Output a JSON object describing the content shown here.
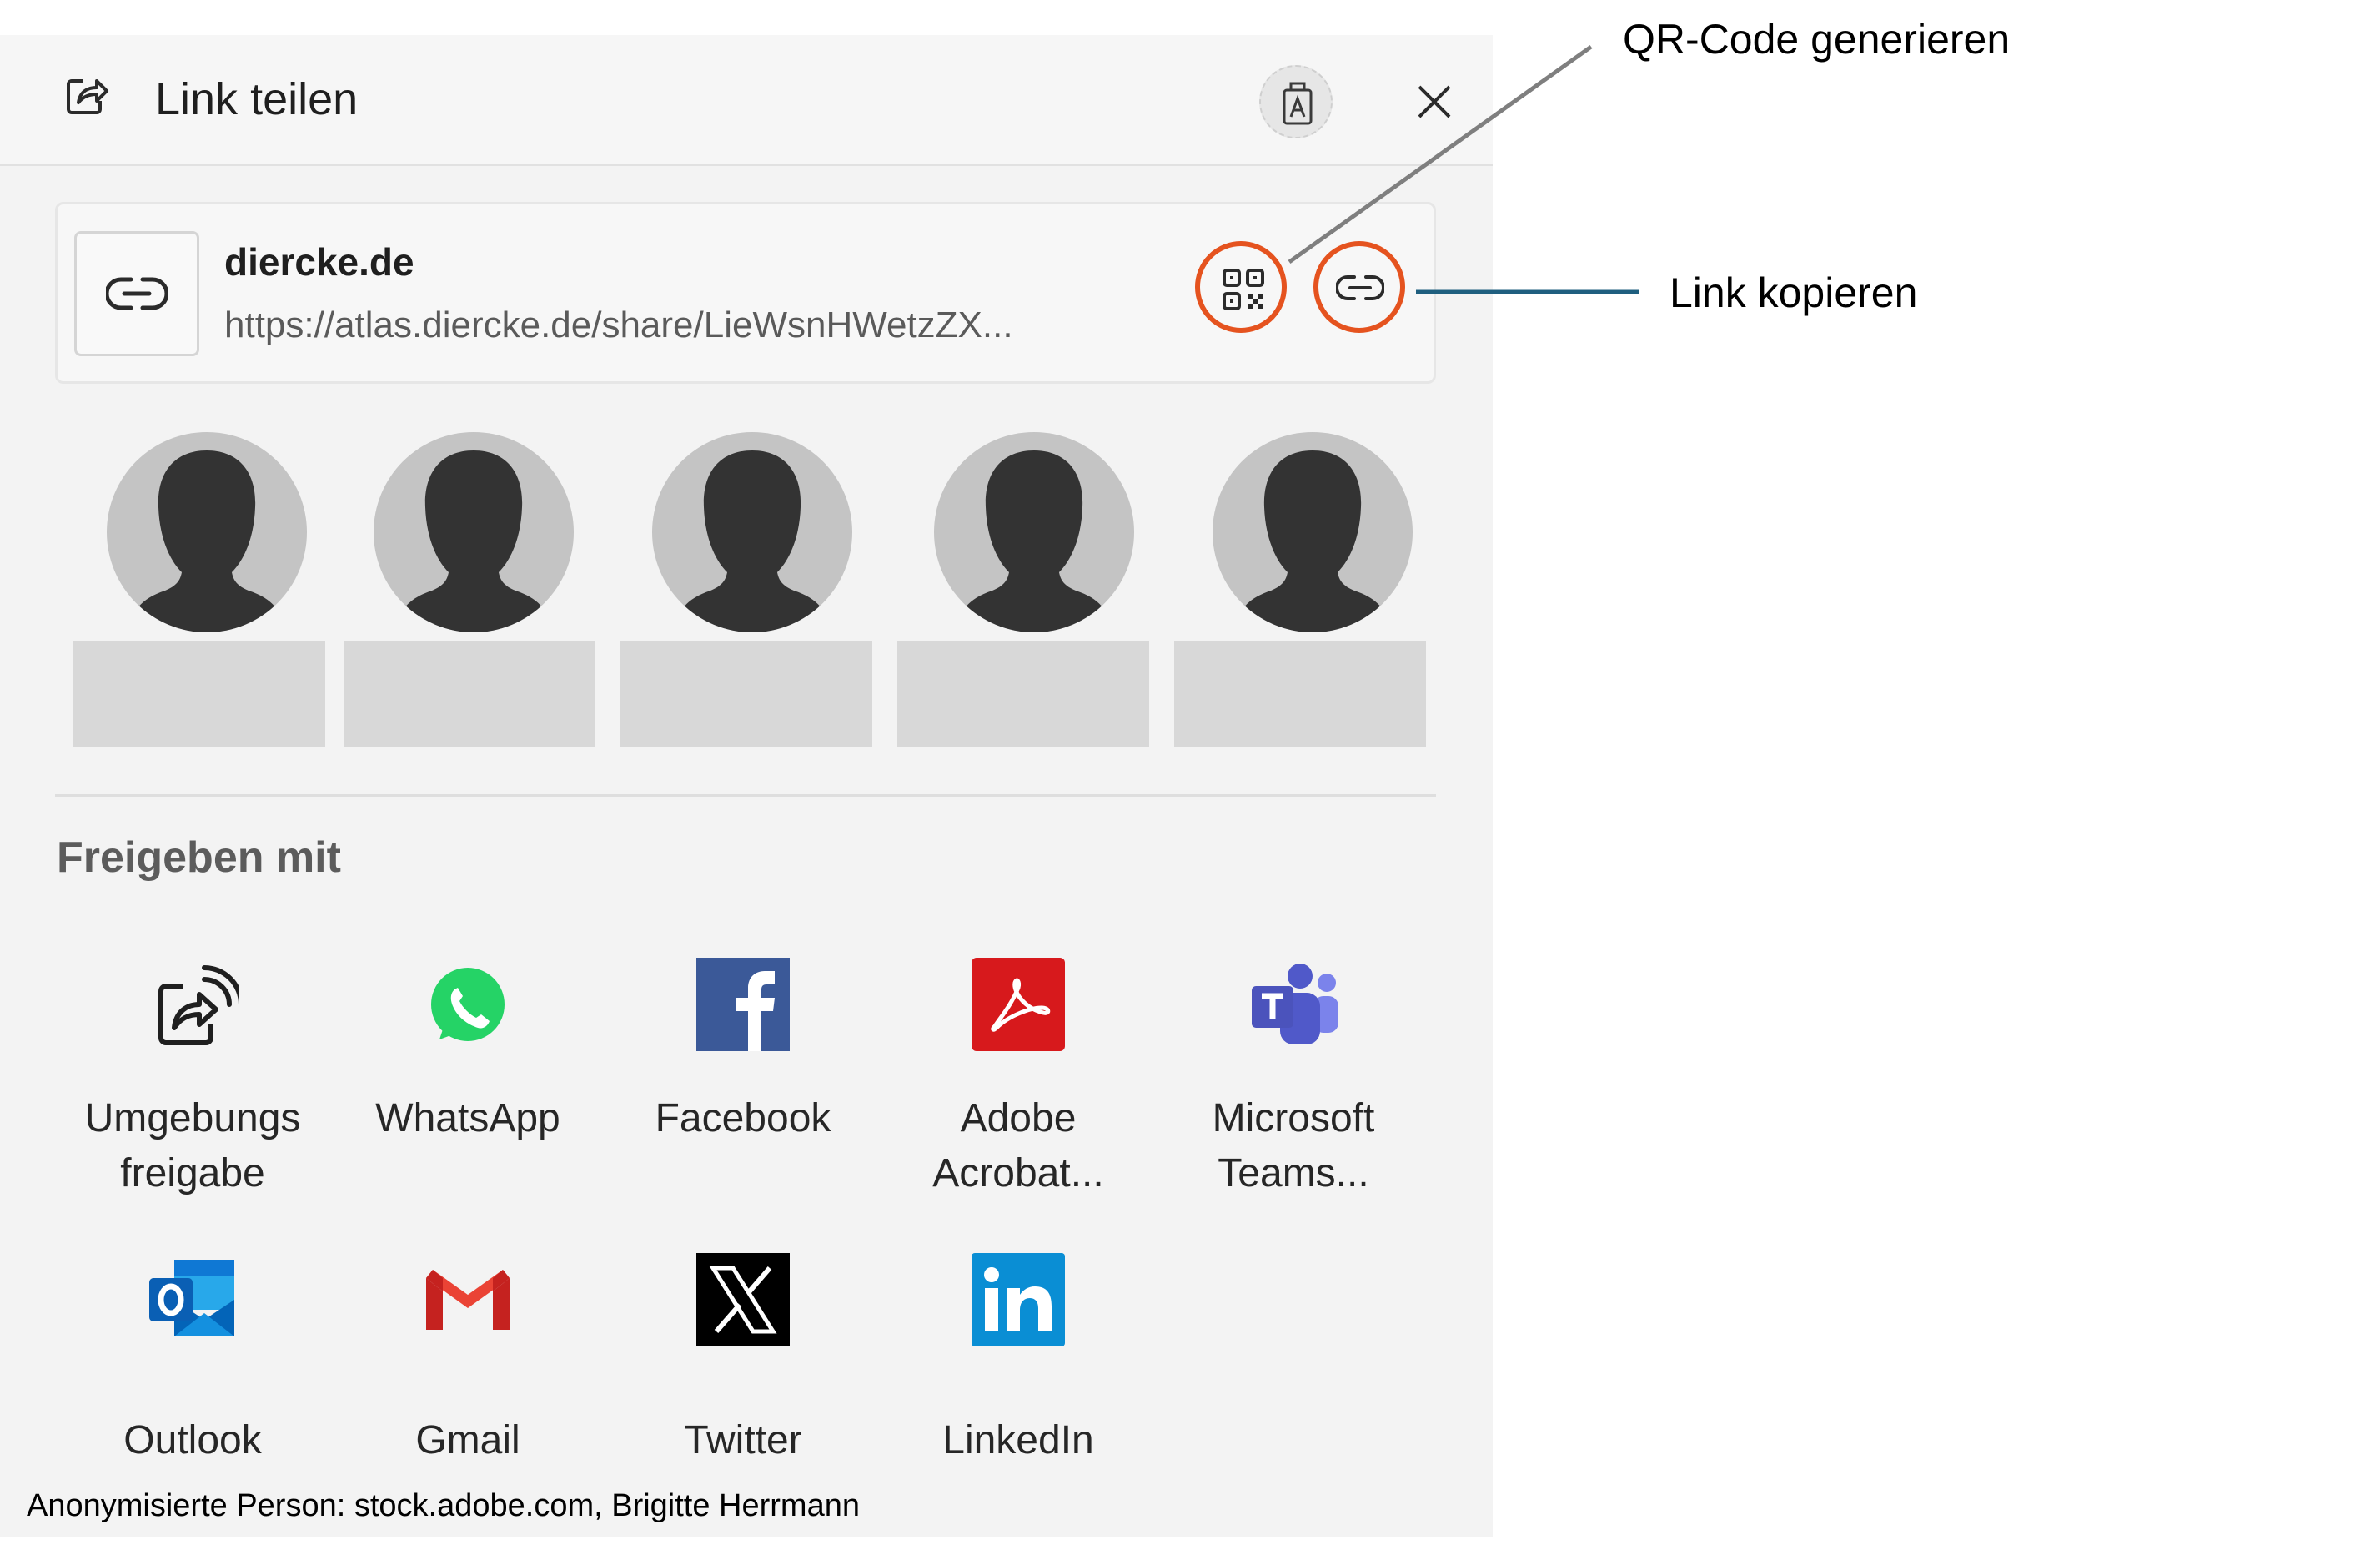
{
  "header": {
    "title": "Link teilen",
    "icons": {
      "share": "share-arrow-icon",
      "nearby": "nearby-share-icon",
      "close": "close-icon"
    }
  },
  "link_card": {
    "domain": "diercke.de",
    "url": "https://atlas.diercke.de/share/LieWsnHWetzZX...",
    "icons": {
      "thumbnail": "link-icon",
      "qr": "qr-code-icon",
      "copy": "copy-link-icon"
    },
    "highlight_color": "#e5531f"
  },
  "contacts": [
    {
      "avatar": "anonymous-person-avatar"
    },
    {
      "avatar": "anonymous-person-avatar"
    },
    {
      "avatar": "anonymous-person-avatar"
    },
    {
      "avatar": "anonymous-person-avatar"
    },
    {
      "avatar": "anonymous-person-avatar"
    }
  ],
  "share_section": {
    "title": "Freigeben mit",
    "apps": [
      {
        "line1": "Umgebungs",
        "line2": "freigabe",
        "icon": "nearby-share-icon"
      },
      {
        "line1": "WhatsApp",
        "line2": "",
        "icon": "whatsapp-icon"
      },
      {
        "line1": "Facebook",
        "line2": "",
        "icon": "facebook-icon"
      },
      {
        "line1": "Adobe",
        "line2": "Acrobat...",
        "icon": "adobe-acrobat-icon"
      },
      {
        "line1": "Microsoft",
        "line2": "Teams...",
        "icon": "microsoft-teams-icon"
      },
      {
        "line1": "Outlook",
        "line2": "",
        "icon": "outlook-icon"
      },
      {
        "line1": "Gmail",
        "line2": "",
        "icon": "gmail-icon"
      },
      {
        "line1": "Twitter",
        "line2": "",
        "icon": "x-twitter-icon"
      },
      {
        "line1": "LinkedIn",
        "line2": "",
        "icon": "linkedin-icon"
      }
    ]
  },
  "annotations": {
    "qr_label": "QR-Code generieren",
    "copy_label": "Link kopieren",
    "qr_line_color": "#7f7f7f",
    "copy_line_color": "#1f5f7f"
  },
  "credit": "Anonymisierte Person: stock.adobe.com, Brigitte Herrmann"
}
